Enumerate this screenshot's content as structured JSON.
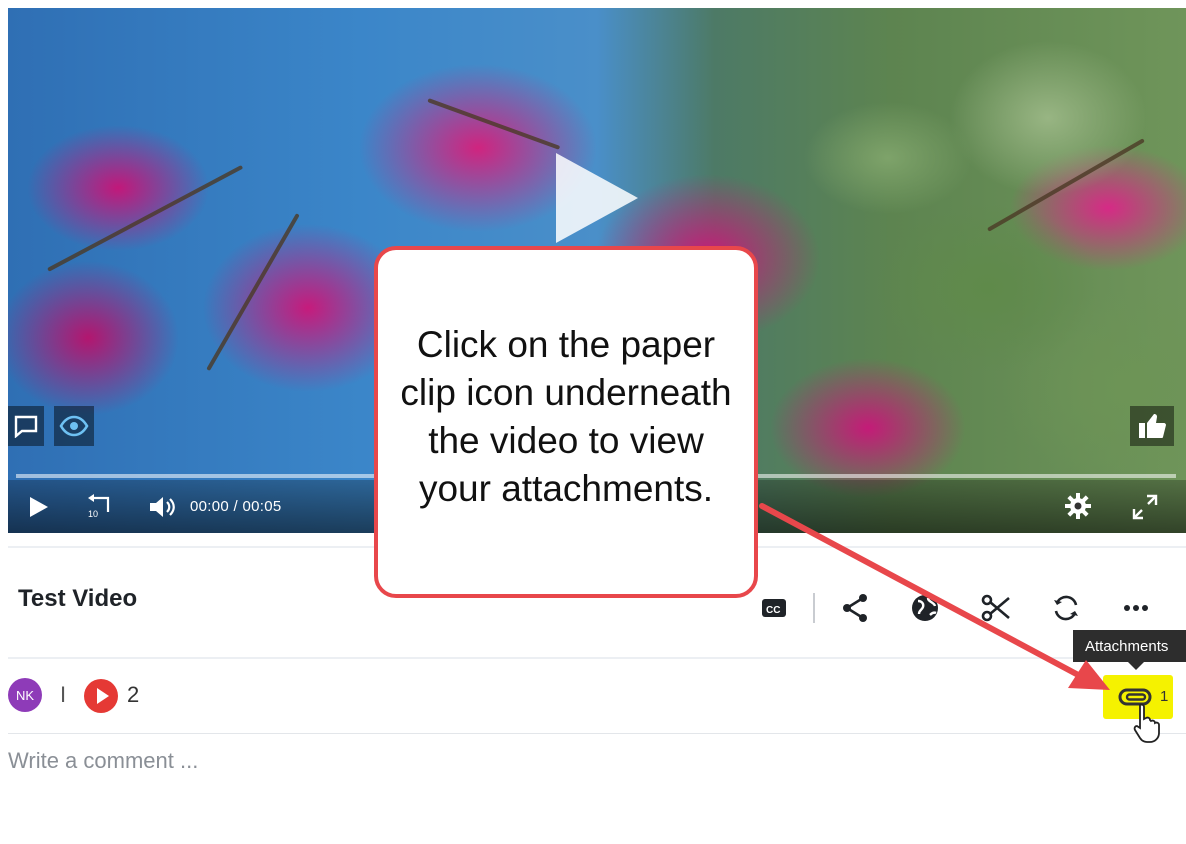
{
  "video": {
    "current_time": "00:00",
    "time_separator": "/",
    "duration": "00:05",
    "rewind_seconds": "10"
  },
  "callout": {
    "text": "Click on the paper clip icon underneath the video to view your attachments."
  },
  "title": "Test Video",
  "meta": {
    "avatar_initials": "NK",
    "separator": "I",
    "play_count": "2",
    "attachment_count": "1"
  },
  "tooltip": "Attachments",
  "comment": {
    "placeholder": "Write a comment ..."
  },
  "colors": {
    "callout_border": "#e8474b",
    "arrow": "#e8474b",
    "highlight": "#f5f200",
    "avatar": "#8e3bb8",
    "play_badge": "#e53935"
  },
  "icons": [
    "comment-icon",
    "eye-icon",
    "like-icon",
    "play-icon",
    "rewind-10-icon",
    "volume-icon",
    "settings-gear-icon",
    "fullscreen-icon",
    "closed-captions-icon",
    "share-icon",
    "globe-icon",
    "scissors-icon",
    "sync-icon",
    "more-icon",
    "paperclip-icon",
    "cursor-hand-icon"
  ]
}
